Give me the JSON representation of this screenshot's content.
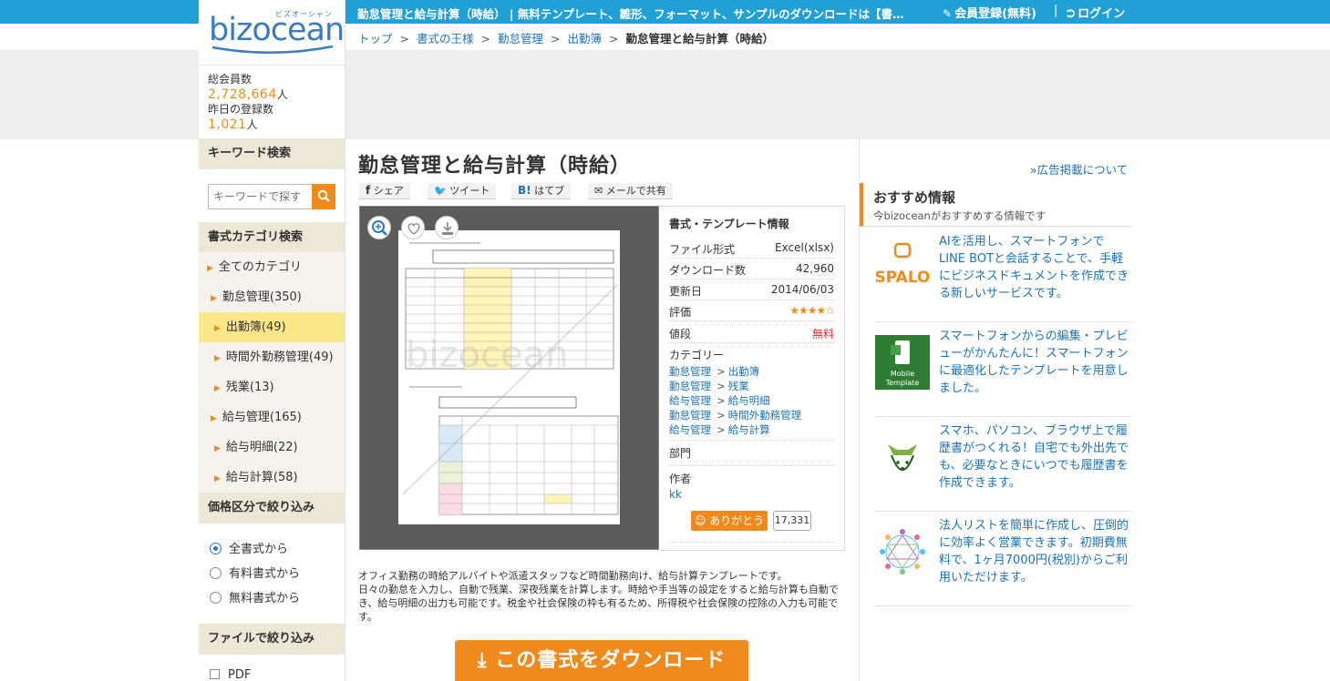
{
  "topbar": {
    "title": "勤怠管理と給与計算（時給） | 無料テンプレート、雛形、フォーマット、サンプルのダウンロードは【書式の…",
    "member_link": "会員登録(無料)",
    "separator": "|",
    "login_link": "ログイン",
    "accent_color": "#21a0d6"
  },
  "logo": {
    "text": "bizocean",
    "kana": "ビズオーシャン"
  },
  "stats": {
    "total_label": "総会員数",
    "total_value": "2,728,664",
    "unit": "人",
    "yesterday_label": "昨日の登録数",
    "yesterday_value": "1,021"
  },
  "breadcrumb": {
    "items": [
      "トップ",
      "書式の王様",
      "勤怠管理",
      "出勤簿"
    ],
    "separator": ">",
    "current": "勤怠管理と給与計算（時給）"
  },
  "sidebar": {
    "keyword_head": "キーワード検索",
    "keyword_placeholder": "キーワードで探す",
    "category_head": "書式カテゴリ検索",
    "categories": [
      {
        "label": "全てのカテゴリ"
      },
      {
        "label": "勤怠管理(350)"
      },
      {
        "label": "出勤簿(49)"
      },
      {
        "label": "時間外勤務管理(49)"
      },
      {
        "label": "残業(13)"
      },
      {
        "label": "給与管理(165)"
      },
      {
        "label": "給与明細(22)"
      },
      {
        "label": "給与計算(58)"
      }
    ],
    "price_head": "価格区分で絞り込み",
    "price_options": [
      "全書式から",
      "有料書式から",
      "無料書式から"
    ],
    "file_head": "ファイルで絞り込み",
    "file_options": [
      "PDF"
    ]
  },
  "main": {
    "title": "勤怠管理と給与計算（時給）",
    "share": {
      "facebook": "シェア",
      "twitter": "ツイート",
      "hatena_mark": "B!",
      "hatena": "はてブ",
      "mail": "メールで共有"
    },
    "info": {
      "title": "書式・テンプレート情報",
      "rows": [
        {
          "label": "ファイル形式",
          "value": "Excel(xlsx)"
        },
        {
          "label": "ダウンロード数",
          "value": "42,960"
        },
        {
          "label": "更新日",
          "value": "2014/06/03"
        }
      ],
      "rating_label": "評価",
      "rating_value": 4.5,
      "rating_stars": "★★★★☆",
      "price_label": "値段",
      "price_value": "無料",
      "category_label": "カテゴリー",
      "category_links": [
        {
          "parent": "勤怠管理",
          "child": "出勤簿"
        },
        {
          "parent": "勤怠管理",
          "child": "残業"
        },
        {
          "parent": "給与管理",
          "child": "給与明細"
        },
        {
          "parent": "勤怠管理",
          "child": "時間外勤務管理"
        },
        {
          "parent": "給与管理",
          "child": "給与計算"
        }
      ],
      "cat_separator": ">",
      "dept_label": "部門",
      "author_label": "作者",
      "author_value": "kk",
      "thanks_label": "ありがとう",
      "thanks_count": "17,331"
    },
    "description": [
      "オフィス勤務の時給アルバイトや派遣スタッフなど時間勤務向け、給与計算テンプレートです。",
      "日々の勤怠を入力し、自動で残業、深夜残業を計算します。時給や手当等の設定をすると給与計算も自動でき、給与明細の出力も可能です。税金や社会保険の枠も有るため、所得税や社会保険の控除の入力も可能です。"
    ],
    "download_label": "この書式をダウンロード"
  },
  "right": {
    "ad_link": "»広告掲載について",
    "rec_title": "おすすめ情報",
    "rec_sub": "今bizoceanがおすすめする情報です",
    "items": [
      {
        "icon": "spalo-logo",
        "logo_text": "SPALO",
        "text": "AIを活用し、スマートフォンでLINE BOTと会話することで、手軽にビジネスドキュメントを作成できる新しいサービスです。"
      },
      {
        "icon": "mobile-template-logo",
        "logo_text": "Mobile Template",
        "text": "スマートフォンからの編集・プレビューがかんたんに！スマートフォンに最適化したテンプレートを用意しました。"
      },
      {
        "icon": "resume-dog-logo",
        "text": "スマホ、パソコン、ブラウザ上で履歴書がつくれる！自宅でも外出先でも、必要なときにいつでも履歴書を作成できます。"
      },
      {
        "icon": "network-logo",
        "text": "法人リストを簡単に作成し、圧倒的に効率よく営業できます。初期費無料で、1ヶ月7000円(税別)からご利用いただけます。"
      }
    ]
  }
}
